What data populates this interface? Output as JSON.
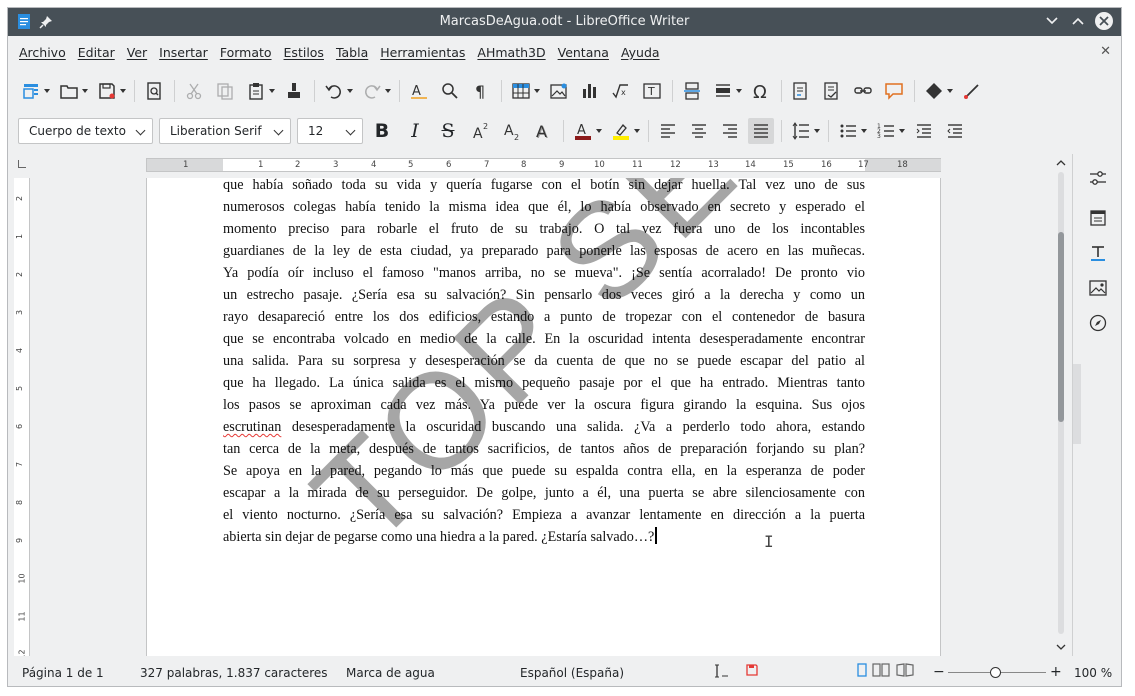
{
  "window": {
    "title": "MarcasDeAgua.odt - LibreOffice Writer"
  },
  "menu": [
    "Archivo",
    "Editar",
    "Ver",
    "Insertar",
    "Formato",
    "Estilos",
    "Tabla",
    "Herramientas",
    "AHmath3D",
    "Ventana",
    "Ayuda"
  ],
  "formatting": {
    "paragraph_style": "Cuerpo de texto",
    "font_name": "Liberation Serif",
    "font_size": "12"
  },
  "ruler": {
    "h_numbers": [
      "1",
      "1",
      "2",
      "3",
      "4",
      "5",
      "6",
      "7",
      "8",
      "9",
      "10",
      "11",
      "12",
      "13",
      "14",
      "15",
      "16",
      "17",
      "18"
    ],
    "v_numbers": [
      "2",
      "1",
      "2",
      "3",
      "4",
      "5",
      "6",
      "7",
      "8",
      "9",
      "10",
      "11",
      "12",
      "13",
      "14"
    ]
  },
  "document": {
    "lines": [
      "que había soñado toda su vida y quería fugarse con el botín sin dejar huella. Tal vez uno de sus",
      "numerosos colegas había tenido la misma idea que él, lo había observado en secreto y esperado el",
      "momento preciso para robarle el fruto de su trabajo. O tal vez fuera uno de los incontables",
      "guardianes de la ley de esta ciudad, ya preparado para ponerle las esposas de acero en las muñecas.",
      "Ya podía oír incluso el famoso  \"manos arriba, no se mueva\". ¡Se sentía acorralado! De pronto vio",
      "un estrecho pasaje. ¿Sería esa su salvación? Sin pensarlo dos veces giró a la derecha y como un",
      "rayo desapareció entre los dos edificios, estando a punto de tropezar con el contenedor de basura",
      "que se encontraba volcado en medio de la calle. En la oscuridad intenta desesperadamente encontrar",
      "una salida. Para su sorpresa y desesperación se da cuenta de que no se puede escapar del patio al",
      "que ha llegado. La única salida es el mismo pequeño pasaje por el que ha entrado. Mientras tanto",
      "los pasos se aproximan cada vez más. Ya puede ver la oscura figura girando la esquina. Sus ojos",
      "desesperadamente la oscuridad buscando una salida. ¿Va a perderlo todo ahora, estando",
      "tan cerca de la meta, después de tantos sacrificios, de tantos años de preparación forjando su plan?",
      "Se apoya en la pared, pegando lo más que puede su espalda contra ella, en la esperanza de poder",
      "escapar a la mirada de su perseguidor. De golpe, junto a él, una puerta se abre silenciosamente con",
      "el viento nocturno. ¿Sería esa su salvación? Empieza a avanzar lentamente en dirección a la puerta",
      "abierta sin dejar de pegarse como una hiedra a la pared. ¿Estaría salvado…?"
    ],
    "misspelled_word": "escrutinan",
    "watermark": "TOP SECRET"
  },
  "status": {
    "page": "Página 1 de 1",
    "words": "327 palabras, 1.837 caracteres",
    "page_style": "Marca de agua",
    "language": "Español (España)",
    "zoom": "100 %",
    "zoom_minus": "−",
    "zoom_plus": "+"
  },
  "icons": [
    "writer-app-icon",
    "pin-icon",
    "minimize-icon",
    "maximize-icon",
    "close-icon"
  ]
}
